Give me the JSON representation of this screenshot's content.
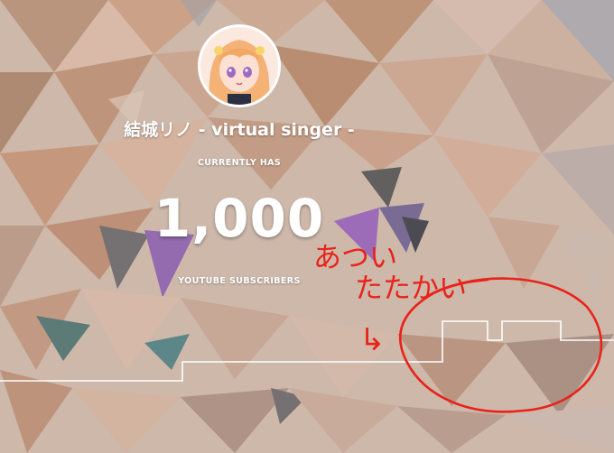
{
  "channel": {
    "name": "結城リノ",
    "suffix": " - virtual singer -"
  },
  "counter": {
    "caption_top": "CURRENTLY HAS",
    "value": "1,000",
    "caption_bottom": "YOUTUBE SUBSCRIBERS"
  },
  "annotation": {
    "line1": "あつい",
    "line2": "たたかい",
    "arrow": "↳",
    "color": "#e8231a"
  },
  "graph": {
    "line_color": "#ffffff"
  }
}
